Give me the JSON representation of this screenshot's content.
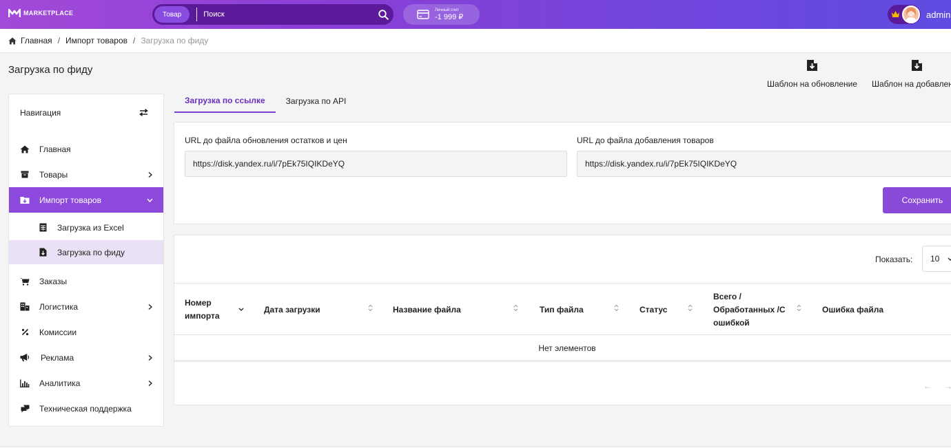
{
  "header": {
    "logo_text": "MARKETPLACE",
    "search_category": "Товар",
    "search_placeholder": "Поиск",
    "account_label": "Личный счет",
    "account_balance": "-1 999 ₽",
    "user_name": "admin"
  },
  "breadcrumb": {
    "home": "Главная",
    "parent": "Импорт товаров",
    "current": "Загрузка по фиду",
    "separator": "/"
  },
  "page": {
    "title": "Загрузка по фиду",
    "template_update": "Шаблон на обновление",
    "template_add": "Шаблон на добавление"
  },
  "sidebar": {
    "heading": "Навигация",
    "items": [
      {
        "label": "Главная",
        "icon": "home-icon"
      },
      {
        "label": "Товары",
        "icon": "box-icon"
      },
      {
        "label": "Импорт товаров",
        "icon": "import-folder-icon"
      },
      {
        "label": "Загрузка из Excel",
        "icon": "spreadsheet-icon"
      },
      {
        "label": "Загрузка по фиду",
        "icon": "file-download-icon"
      },
      {
        "label": "Заказы",
        "icon": "cart-icon"
      },
      {
        "label": "Логистика",
        "icon": "buildings-icon"
      },
      {
        "label": "Комиссии",
        "icon": "percent-icon"
      },
      {
        "label": "Реклама",
        "icon": "megaphone-icon"
      },
      {
        "label": "Аналитика",
        "icon": "bar-chart-icon"
      },
      {
        "label": "Техническая поддержка",
        "icon": "chat-icon"
      }
    ]
  },
  "tabs": [
    {
      "label": "Загрузка по ссылке",
      "active": true
    },
    {
      "label": "Загрузка по API",
      "active": false
    }
  ],
  "form": {
    "update_url_label": "URL до файла обновления остатков и цен",
    "update_url_value": "https://disk.yandex.ru/i/7pEk75IQIKDeYQ",
    "add_url_label": "URL до файла добавления товаров",
    "add_url_value": "https://disk.yandex.ru/i/7pEk75IQIKDeYQ",
    "save_label": "Сохранить"
  },
  "table": {
    "show_label": "Показать:",
    "page_size": "10",
    "columns": [
      "Номер импорта",
      "Дата загрузки",
      "Название файла",
      "Тип файла",
      "Статус",
      "Всего / Обработанных /С ошибкой",
      "Ошибка файла"
    ],
    "empty_text": "Нет элементов",
    "prev": "←",
    "next": "→"
  },
  "colors": {
    "accent": "#8a4ad9",
    "header_gradient_start": "#a24ad9",
    "header_gradient_end": "#5f4ce0",
    "active_tab": "#6a2fbf",
    "sub_active_bg": "#ebe1f7"
  }
}
